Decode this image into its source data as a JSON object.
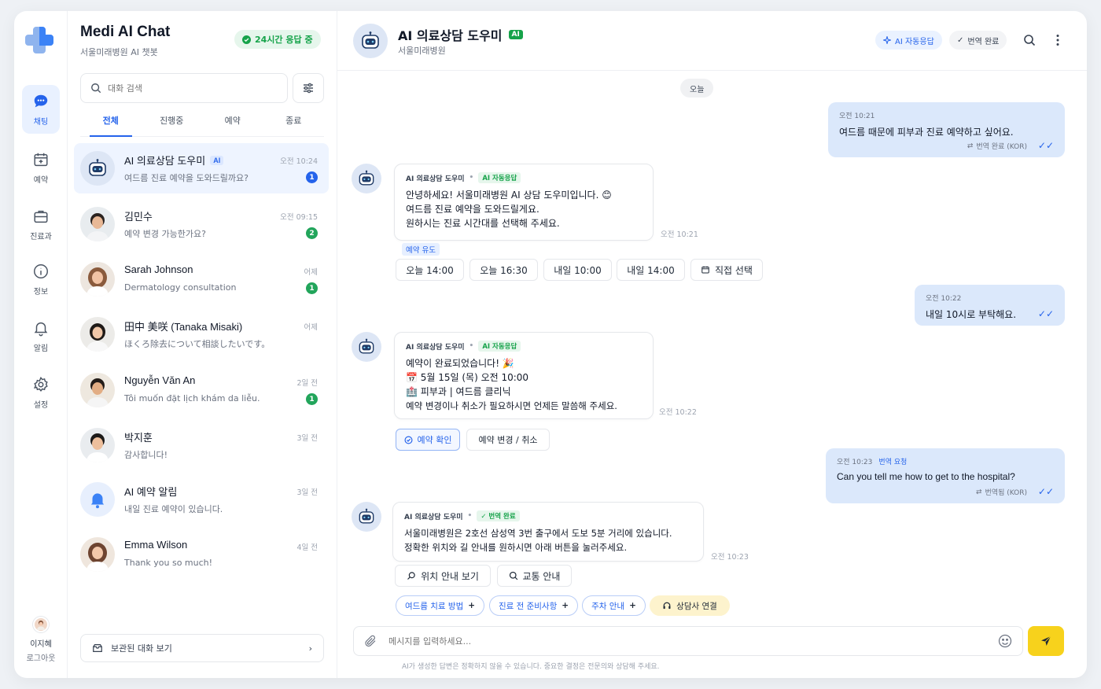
{
  "colors": {
    "accent": "#2563eb",
    "green": "#16a34a",
    "send": "#f7d21c",
    "user_bubble": "#dbe8fb"
  },
  "app": {
    "title": "Medi AI Chat",
    "subtitle": "서울미래병원 AI 챗봇",
    "status_badge": "24시간 응답 중"
  },
  "rail": {
    "items": [
      {
        "label": "채팅",
        "icon": "chat-icon"
      },
      {
        "label": "예약",
        "icon": "calendar-icon"
      },
      {
        "label": "진료과",
        "icon": "medical-bag-icon"
      },
      {
        "label": "정보",
        "icon": "info-icon"
      },
      {
        "label": "알림",
        "icon": "bell-icon"
      },
      {
        "label": "설정",
        "icon": "gear-icon"
      }
    ],
    "user": {
      "name": "이지혜",
      "logout": "로그아웃"
    }
  },
  "search": {
    "placeholder": "대화 검색"
  },
  "tabs": [
    "전체",
    "진행중",
    "예약",
    "종료"
  ],
  "conversations": [
    {
      "name": "AI 의료상담 도우미",
      "tag": "AI",
      "preview": "여드름 진료 예약을 도와드릴까요?",
      "time": "오전 10:24",
      "count": "1"
    },
    {
      "name": "김민수",
      "preview": "예약 변경 가능한가요?",
      "time": "오전 09:15",
      "count": "2"
    },
    {
      "name": "Sarah Johnson",
      "preview": "Dermatology consultation",
      "time": "어제",
      "count": "1"
    },
    {
      "name": "田中 美咲 (Tanaka Misaki)",
      "preview": "ほくろ除去について相談したいです。",
      "time": "어제"
    },
    {
      "name": "Nguyễn Văn An",
      "preview": "Tôi muốn đặt lịch khám da liễu.",
      "time": "2일 전",
      "count": "1"
    },
    {
      "name": "박지훈",
      "preview": "감사합니다!",
      "time": "3일 전"
    },
    {
      "name": "AI 예약 알림",
      "preview": "내일 진료 예약이 있습니다.",
      "time": "3일 전"
    },
    {
      "name": "Emma Wilson",
      "preview": "Thank you so much!",
      "time": "4일 전"
    }
  ],
  "saved_chats": "보관된 대화 보기",
  "chat": {
    "title": "AI 의료상담 도우미",
    "title_tag": "AI",
    "subtitle": "서울미래병원",
    "pill_ai": "AI 자동응답",
    "pill_translate": "번역 완료",
    "date_divider": "오늘",
    "messages": {
      "u1": {
        "time": "오전 10:21",
        "text": "여드름 때문에 피부과 진료 예약하고 싶어요.",
        "trans": "번역 완료 (KOR)"
      },
      "b1": {
        "sender": "AI 의료상담 도우미",
        "tag": "AI 자동응답",
        "lines": [
          "안녕하세요! 서울미래병원 AI 상담 도우미입니다. 😊",
          "여드름 진료 예약을 도와드릴게요.",
          "원하시는 진료 시간대를 선택해 주세요."
        ],
        "time": "오전 10:21",
        "hint": "예약 유도",
        "options": [
          "오늘 14:00",
          "오늘 16:30",
          "내일 10:00",
          "내일 14:00",
          "직접 선택"
        ]
      },
      "u2": {
        "time": "오전 10:22",
        "text": "내일 10시로 부탁해요."
      },
      "b2": {
        "sender": "AI 의료상담 도우미",
        "tag": "AI 자동응답",
        "lines": [
          "예약이 완료되었습니다! 🎉",
          "📅 5월 15일 (목) 오전 10:00",
          "🏥 피부과 | 여드름 클리닉",
          "예약 변경이나 취소가 필요하시면 언제든 말씀해 주세요."
        ],
        "time": "오전 10:22",
        "actions": [
          "예약 확인",
          "예약 변경 / 취소"
        ]
      },
      "u3": {
        "time": "오전 10:23",
        "req": "번역 요청",
        "text": "Can you tell me how to get to the hospital?",
        "trans": "번역됨 (KOR)"
      },
      "b3": {
        "sender": "AI 의료상담 도우미",
        "tag": "번역 완료",
        "lines": [
          "서울미래병원은 2호선 삼성역 3번 출구에서 도보 5분 거리에 있습니다.",
          "정확한 위치와 길 안내를 원하시면 아래 버튼을 눌러주세요."
        ],
        "time": "오전 10:23",
        "actions": [
          "위치 안내 보기",
          "교통 안내"
        ]
      }
    },
    "quick_replies": [
      "여드름 치료 방법",
      "진료 전 준비사항",
      "주차 안내",
      "상담사 연결"
    ],
    "composer_placeholder": "메시지를 입력하세요...",
    "disclaimer": "AI가 생성한 답변은 정확하지 않을 수 있습니다. 중요한 결정은 전문의와 상담해 주세요."
  }
}
